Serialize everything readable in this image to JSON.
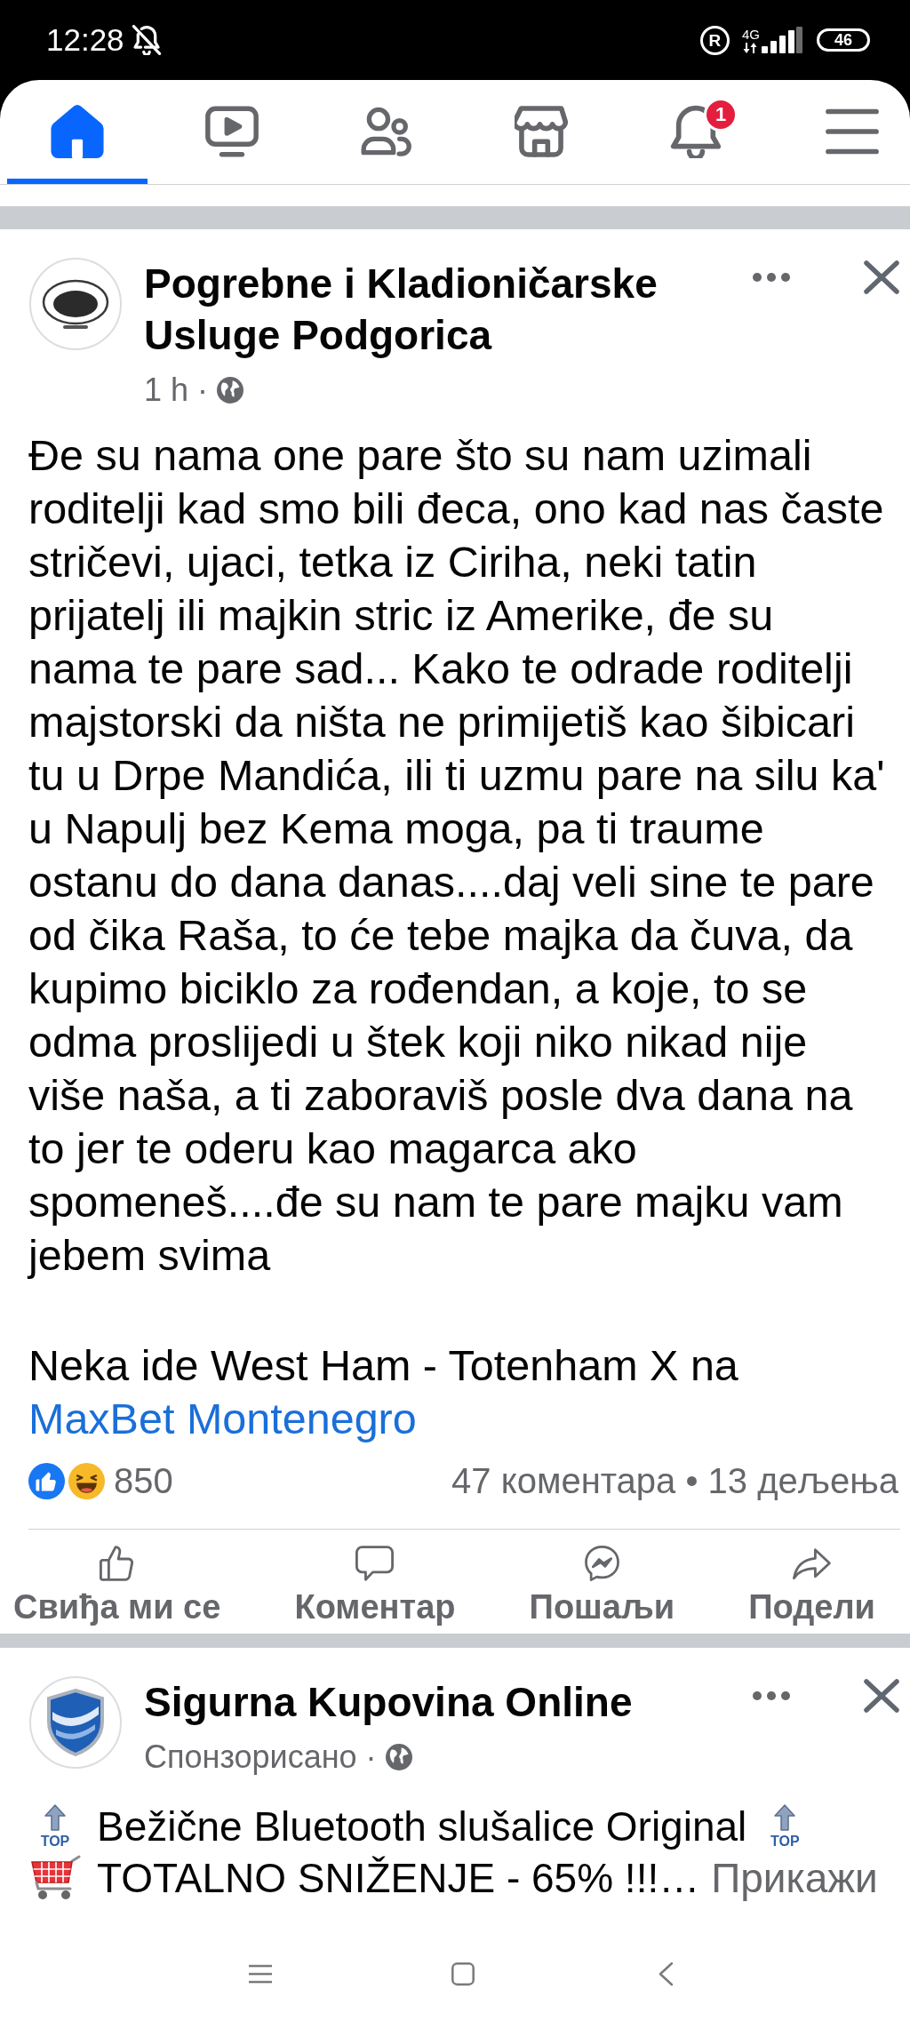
{
  "status_bar": {
    "time": "12:28",
    "roaming": "R",
    "network": "4G",
    "battery": "46"
  },
  "nav_tabs": [
    {
      "kind": "home",
      "selected": true
    },
    {
      "kind": "video",
      "selected": false
    },
    {
      "kind": "friends",
      "selected": false
    },
    {
      "kind": "marketplace",
      "selected": false
    },
    {
      "kind": "notifications",
      "selected": false,
      "badge": "1"
    },
    {
      "kind": "menu",
      "selected": false
    }
  ],
  "post": {
    "author": "Pogrebne i Kladioničarske Usluge Podgorica",
    "meta": "1 h ·",
    "paragraphs": [
      {
        "text": "Đe su nama one pare što su nam uzimali roditelji kad smo bili đeca, ono kad nas časte stričevi, ujaci, tetka iz Ciriha, neki tatin prijatelj ili majkin stric iz Amerike, đe su nama te pare sad... Kako te odrade roditelji majstorski da ništa ne primijetiš kao šibicari tu u Drpe Mandića, ili ti uzmu pare na silu ka' u Napulj bez Kema moga, pa ti traume ostanu do dana danas....daj veli sine te pare od čika Raša, to će tebe majka da čuva, da kupimo biciklo za rođendan, a koje, to se odma proslijedi u štek koji niko nikad nije više naša, a ti zaboraviš posle dva dana na to jer te oderu kao magarca ako spomeneš....đe su nam te pare majku vam jebem svima"
      },
      {
        "text": "Neka ide West Ham - Totenham X na",
        "link": "MaxBet Montenegro"
      }
    ],
    "reaction_count": "850",
    "counts": "47 коментара • 13 дељења",
    "actions": [
      {
        "kind": "like",
        "label": "Свиђа ми се"
      },
      {
        "kind": "comment",
        "label": "Коментар"
      },
      {
        "kind": "send",
        "label": "Пошаљи"
      },
      {
        "kind": "share",
        "label": "Подели"
      }
    ]
  },
  "sponsored_post": {
    "author": "Sigurna Kupovina Online",
    "meta": "Спонзорисано ·",
    "lines": [
      {
        "parts": [
          {
            "kind": "top_emoji",
            "label": "TOP"
          },
          {
            "kind": "text",
            "text": "Bežične Bluetooth slušalice Original"
          },
          {
            "kind": "top_emoji",
            "label": "TOP"
          }
        ]
      },
      {
        "parts": [
          {
            "kind": "cart_emoji"
          },
          {
            "kind": "text",
            "text": "TOTALNO SNIŽENJE - 65% !!!…"
          },
          {
            "kind": "link",
            "text": "Прикажи"
          }
        ]
      }
    ]
  }
}
